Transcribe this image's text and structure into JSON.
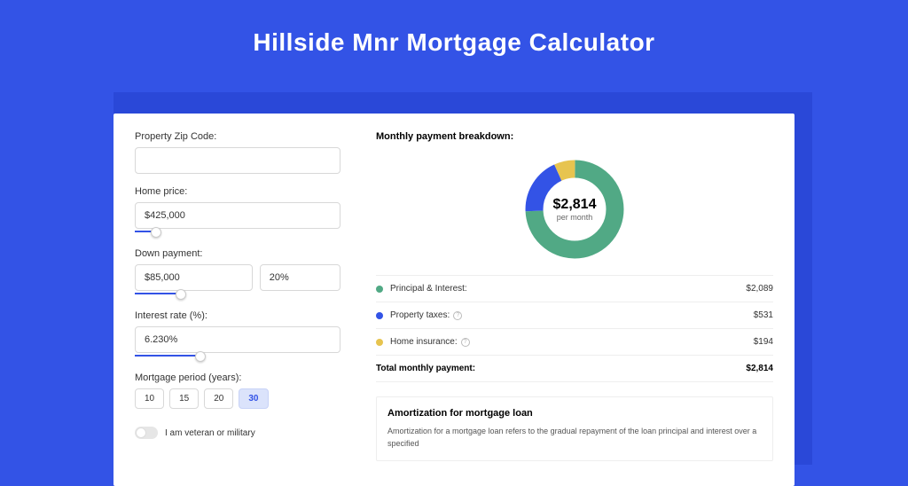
{
  "title": "Hillside Mnr Mortgage Calculator",
  "form": {
    "zip_label": "Property Zip Code:",
    "zip_value": "",
    "home_price_label": "Home price:",
    "home_price_value": "$425,000",
    "down_payment_label": "Down payment:",
    "down_payment_value": "$85,000",
    "down_payment_pct_value": "20%",
    "interest_label": "Interest rate (%):",
    "interest_value": "6.230%",
    "period_label": "Mortgage period (years):",
    "periods": [
      "10",
      "15",
      "20",
      "30"
    ],
    "period_selected": "30",
    "veteran_label": "I am veteran or military"
  },
  "breakdown": {
    "header": "Monthly payment breakdown:",
    "donut_amount": "$2,814",
    "donut_sub": "per month",
    "items": [
      {
        "color": "green",
        "label": "Principal & Interest:",
        "value": "$2,089",
        "info": false
      },
      {
        "color": "blue",
        "label": "Property taxes:",
        "value": "$531",
        "info": true
      },
      {
        "color": "yellow",
        "label": "Home insurance:",
        "value": "$194",
        "info": true
      }
    ],
    "total_label": "Total monthly payment:",
    "total_value": "$2,814"
  },
  "amortization": {
    "title": "Amortization for mortgage loan",
    "text": "Amortization for a mortgage loan refers to the gradual repayment of the loan principal and interest over a specified"
  },
  "chart_data": {
    "type": "pie",
    "title": "Monthly payment breakdown",
    "series": [
      {
        "name": "Principal & Interest",
        "value": 2089,
        "color": "#51a985"
      },
      {
        "name": "Property taxes",
        "value": 531,
        "color": "#3353e6"
      },
      {
        "name": "Home insurance",
        "value": 194,
        "color": "#e7c44f"
      }
    ],
    "total": 2814,
    "center_label": "$2,814 per month"
  }
}
